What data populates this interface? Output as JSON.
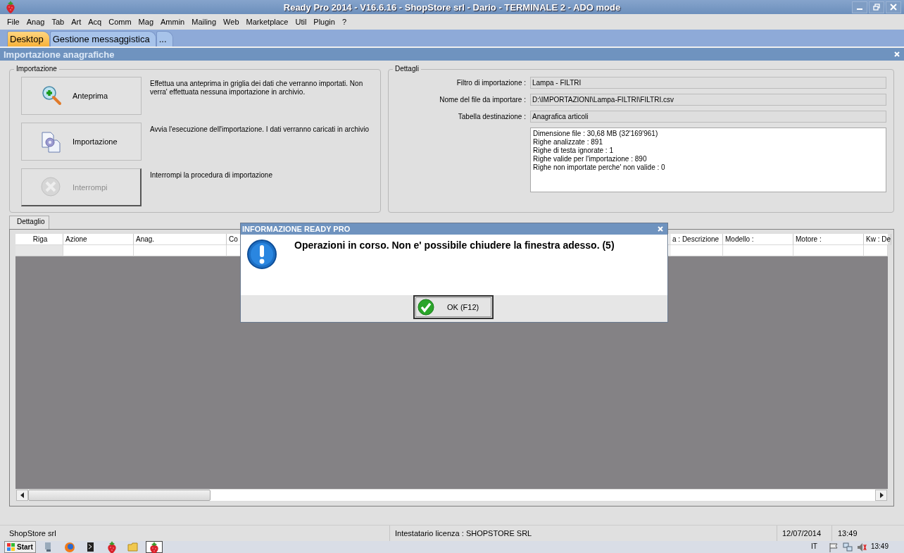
{
  "window": {
    "title": "Ready Pro 2014 - V16.6.16 - ShopStore srl - Dario - TERMINALE 2 - ADO mode"
  },
  "menu": [
    "File",
    "Anag",
    "Tab",
    "Art",
    "Acq",
    "Comm",
    "Mag",
    "Ammin",
    "Mailing",
    "Web",
    "Marketplace",
    "Util",
    "Plugin",
    "?"
  ],
  "tabs": [
    {
      "label": "Desktop",
      "selected": true
    },
    {
      "label": "Gestione messaggistica",
      "selected": false
    },
    {
      "label": "...",
      "selected": false
    }
  ],
  "subwindow": {
    "title": "Importazione anagrafiche"
  },
  "import_group": {
    "title": "Importazione",
    "actions": [
      {
        "kind": "preview",
        "label": "Anteprima",
        "disabled": false,
        "description": "Effettua una anteprima in griglia dei dati che verranno importati. Non verra' effettuata nessuna importazione in archivio."
      },
      {
        "kind": "import",
        "label": "Importazione",
        "disabled": false,
        "description": "Avvia l'esecuzione dell'importazione. I dati verranno caricati in archivio"
      },
      {
        "kind": "stop",
        "label": "Interrompi",
        "disabled": true,
        "description": "Interrompi la procedura di importazione"
      }
    ]
  },
  "details_group": {
    "title": "Dettagli",
    "fields": [
      {
        "label": "Filtro di importazione :",
        "value": "Lampa - FILTRI"
      },
      {
        "label": "Nome del file da importare :",
        "value": "D:\\IMPORTAZIONI\\Lampa-FILTRI\\FILTRI.csv"
      },
      {
        "label": "Tabella destinazione :",
        "value": "Anagrafica articoli"
      }
    ],
    "log": [
      "Dimensione file : 30,68 MB (32'169'961)",
      "Righe analizzate : 891",
      "Righe di testa ignorate : 1",
      "Righe valide per l'importazione : 890",
      "Righe non importate perche' non valide : 0"
    ]
  },
  "grid": {
    "tab": "Dettaglio",
    "columns": [
      "Riga",
      "Azione",
      "Anag.",
      "Co",
      "a : Descrizione",
      "Modello :",
      "Motore :",
      "Kw : De"
    ]
  },
  "dialog": {
    "title": "INFORMAZIONE READY PRO",
    "message": "Operazioni in corso. Non e' possibile chiudere la finestra adesso. (5)",
    "button": "OK (F12)"
  },
  "status_bar": [
    "ShopStore srl",
    "Intestatario licenza : SHOPSTORE SRL",
    "12/07/2014",
    "13:49"
  ],
  "taskbar": {
    "start": "Start",
    "language": "IT",
    "clock": "13:49"
  }
}
